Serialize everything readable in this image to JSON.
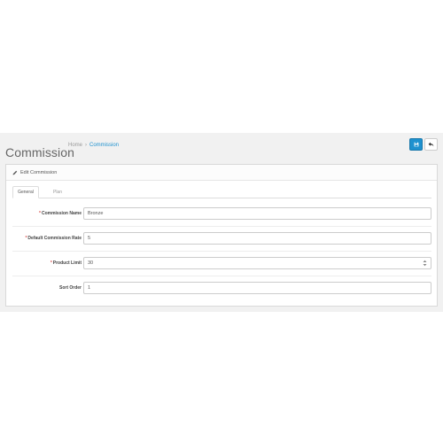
{
  "header": {
    "title": "Commission",
    "breadcrumb": [
      {
        "label": "Home"
      },
      {
        "label": "Commission"
      }
    ]
  },
  "panel": {
    "heading": "Edit Commission",
    "tabs": [
      {
        "label": "General",
        "active": true
      },
      {
        "label": "Plan",
        "active": false
      }
    ]
  },
  "form": {
    "fields": [
      {
        "label": "Commission Name",
        "required": true,
        "value": "Bronze"
      },
      {
        "label": "Default Commission Rate",
        "required": true,
        "value": "5"
      },
      {
        "label": "Product Limit",
        "required": true,
        "value": "30"
      },
      {
        "label": "Sort Order",
        "required": false,
        "value": "1"
      }
    ]
  },
  "colors": {
    "accent": "#1e91cf",
    "required": "#d9534f",
    "background": "#f1f1f1"
  },
  "icons": {
    "save": "save-icon",
    "back": "reply-icon",
    "edit": "pencil-icon"
  }
}
